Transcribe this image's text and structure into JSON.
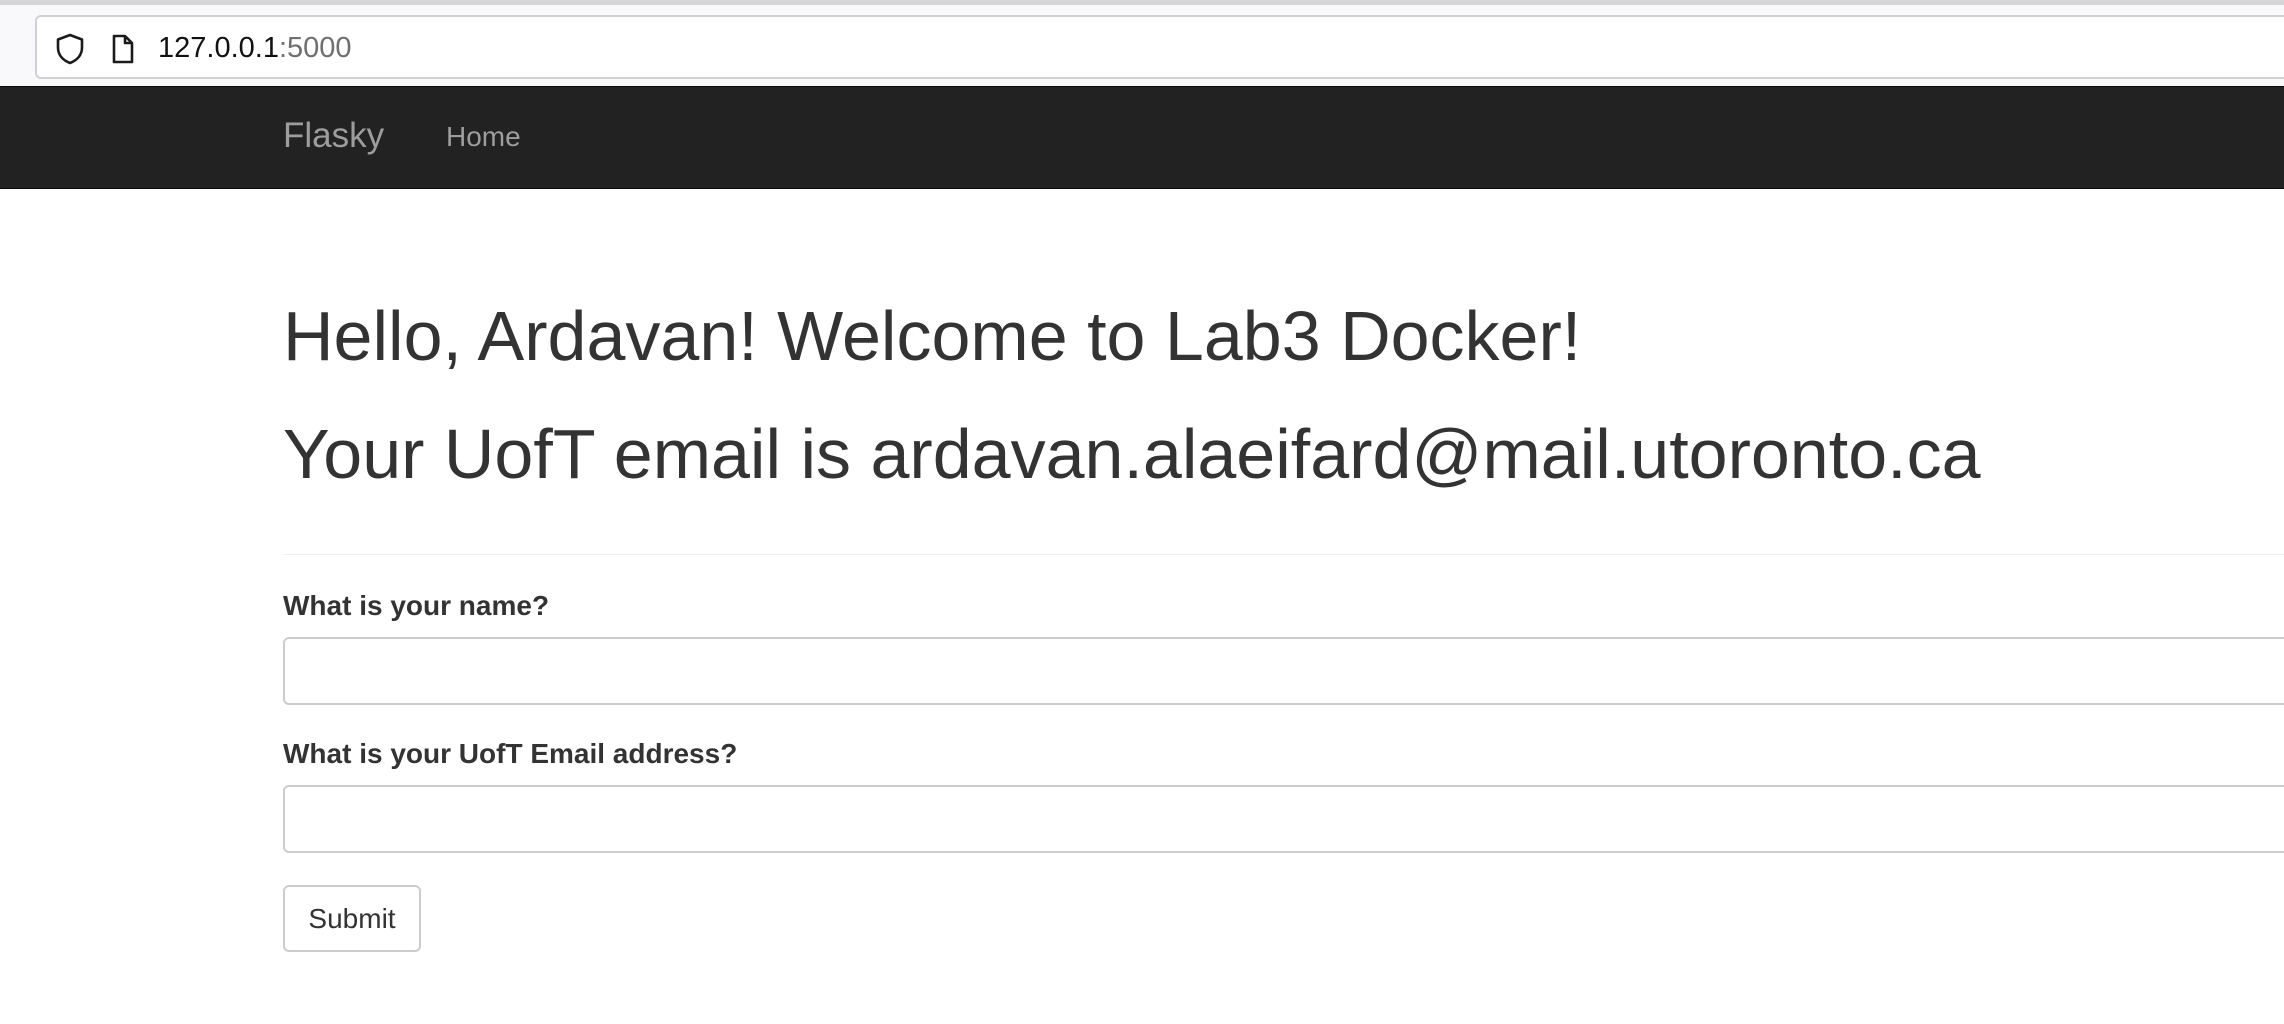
{
  "browser": {
    "url_host": "127.0.0.1",
    "url_port": ":5000",
    "icons": [
      "shield-icon",
      "page-icon"
    ]
  },
  "navbar": {
    "brand": "Flasky",
    "links": [
      {
        "label": "Home"
      }
    ]
  },
  "main": {
    "greeting": "Hello, Ardavan! Welcome to Lab3 Docker!",
    "email_line": "Your UofT email is ardavan.alaeifard@mail.utoronto.ca"
  },
  "form": {
    "name_label": "What is your name?",
    "name_value": "",
    "email_label": "What is your UofT Email address?",
    "email_value": "",
    "submit_label": "Submit"
  },
  "colors": {
    "navbar_bg": "#222222",
    "navbar_text": "#9d9d9d",
    "body_text": "#333333",
    "input_border": "#cccccc"
  }
}
